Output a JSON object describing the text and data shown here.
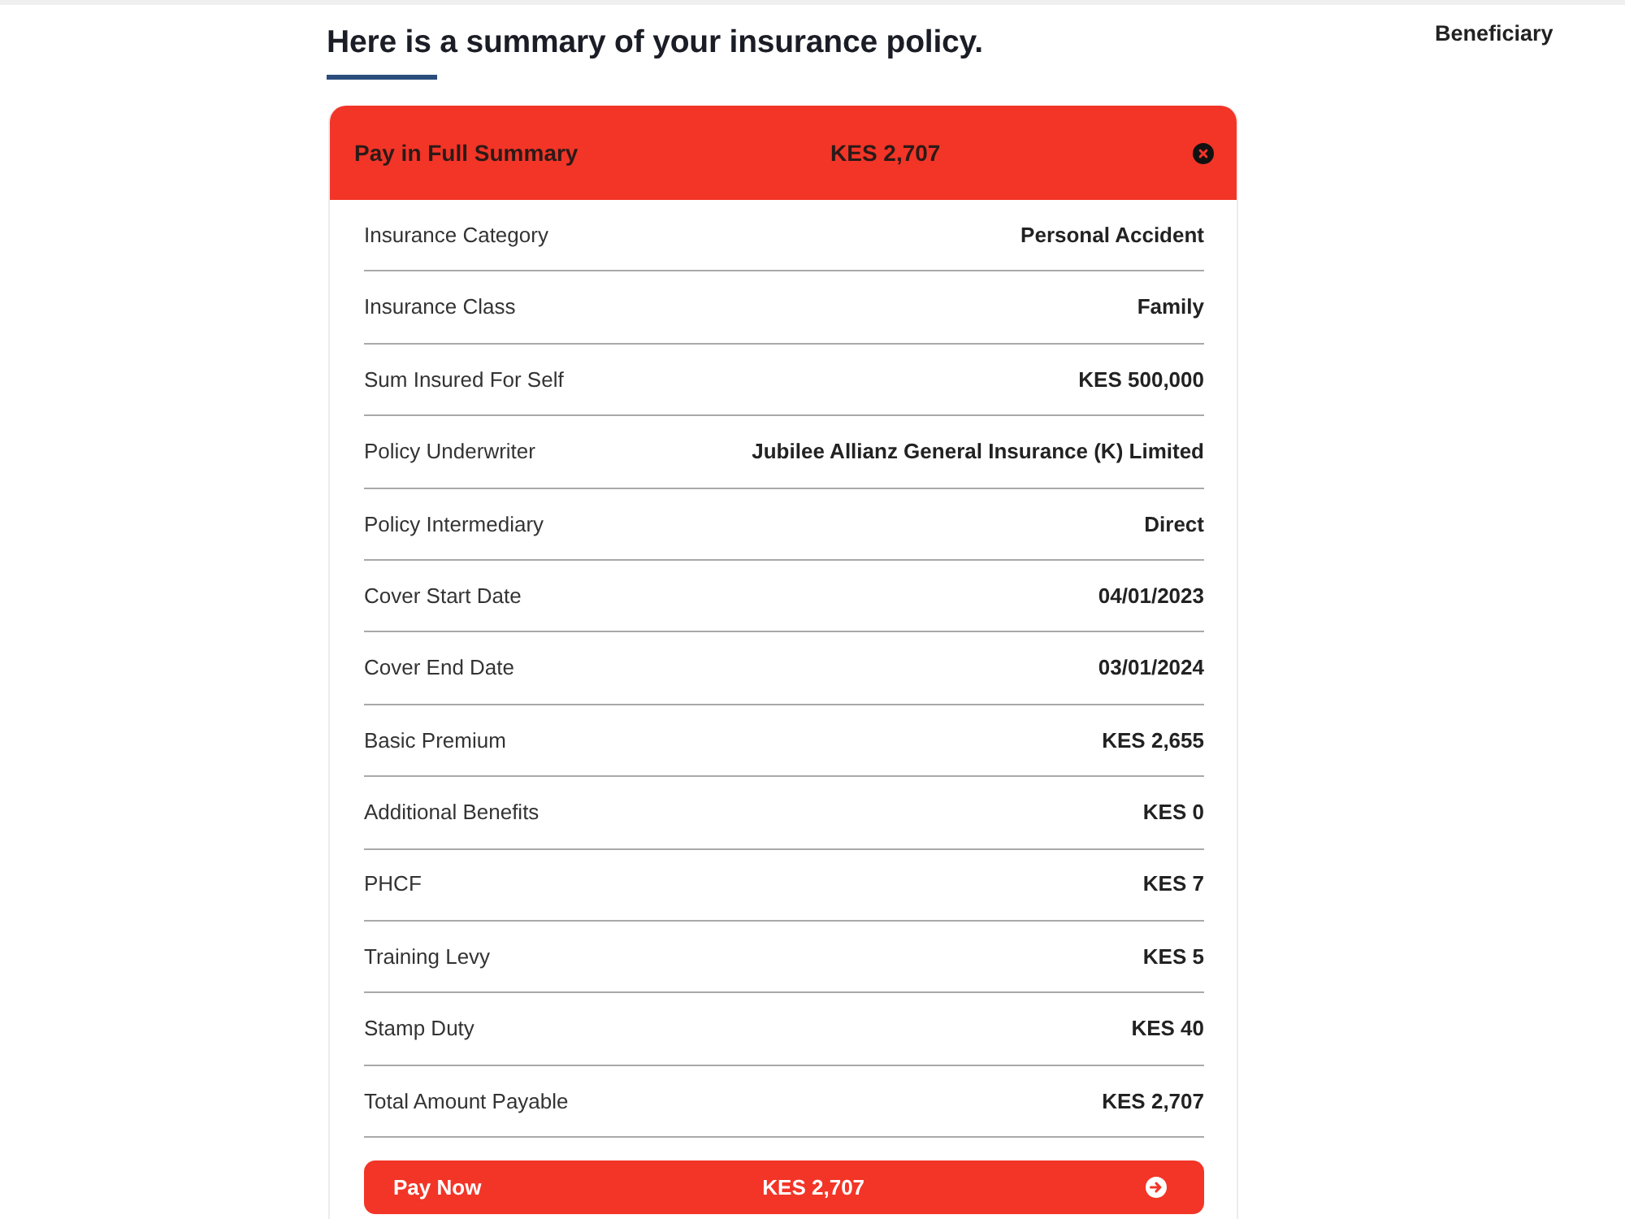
{
  "heading": "Here is a summary of your insurance policy.",
  "side_step": {
    "label": "Beneficiary"
  },
  "summary": {
    "title": "Pay in Full Summary",
    "amount": "KES 2,707",
    "rows": [
      {
        "label": "Insurance Category",
        "value": "Personal Accident"
      },
      {
        "label": "Insurance Class",
        "value": "Family"
      },
      {
        "label": "Sum Insured For Self",
        "value": "KES 500,000"
      },
      {
        "label": "Policy Underwriter",
        "value": "Jubilee Allianz General Insurance (K) Limited"
      },
      {
        "label": "Policy Intermediary",
        "value": "Direct"
      },
      {
        "label": "Cover Start Date",
        "value": "04/01/2023"
      },
      {
        "label": "Cover End Date",
        "value": "03/01/2024"
      },
      {
        "label": "Basic Premium",
        "value": "KES 2,655"
      },
      {
        "label": "Additional Benefits",
        "value": "KES 0"
      },
      {
        "label": "PHCF",
        "value": "KES 7"
      },
      {
        "label": "Training Levy",
        "value": "KES 5"
      },
      {
        "label": "Stamp Duty",
        "value": "KES 40"
      },
      {
        "label": "Total Amount Payable",
        "value": "KES 2,707"
      }
    ],
    "pay_button": {
      "label": "Pay Now",
      "amount": "KES 2,707"
    }
  }
}
